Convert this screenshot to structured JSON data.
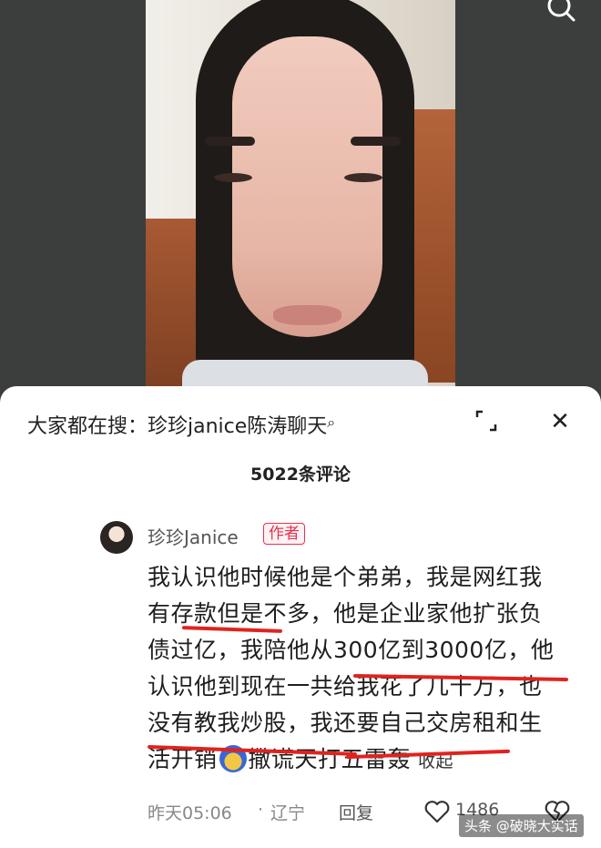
{
  "header": {
    "search_hint": "大家都在搜：珍珍janice陈涛聊天",
    "comment_count": "5022条评论"
  },
  "comment": {
    "username": "珍珍Janice",
    "author_badge": "作者",
    "lines": [
      "我认识他时候他是个弟弟，我是网红我",
      "有存款但是不多，他是企业家他扩张负",
      "债过亿，我陪他从300亿到3000亿，他",
      "认识他到现在一共给我花了几十万，也",
      "没有教我炒股，我还要自己交房租和生",
      "活开销",
      "撒谎天打五雷轰"
    ],
    "collapse_label": "收起",
    "time": "昨天05:06",
    "location": "辽宁",
    "reply_label": "回复",
    "like_count": "1486"
  },
  "watermark": "头条 @破晓大实话",
  "colors": {
    "badge": "#e7324d",
    "underline": "#e0231f"
  },
  "icons": [
    "search-icon",
    "expand-icon",
    "close-icon",
    "like-icon",
    "dislike-icon"
  ]
}
